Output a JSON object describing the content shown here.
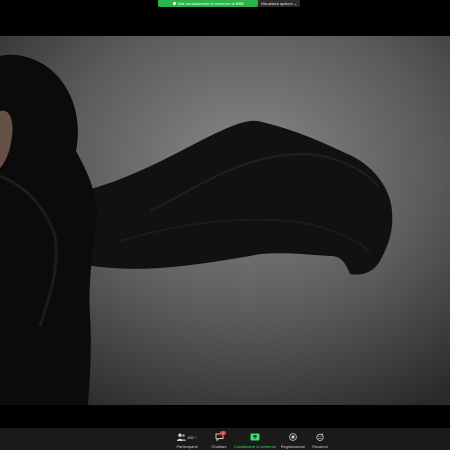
{
  "top_bar": {
    "sharing_label": "Stai visualizzando lo schermo di ∂∂∂∂",
    "view_options_label": "Visualizza opzioni ⌄",
    "accent_color": "#29b34a"
  },
  "shared_screen": {
    "description_icon": "shared-screen-image"
  },
  "toolbar": {
    "participants": {
      "label": "Partecipanti",
      "count": "180",
      "icon": "participants-icon"
    },
    "chat": {
      "label": "Chattare",
      "badge": "1",
      "icon": "chat-icon"
    },
    "share_screen": {
      "label": "Condividere lo schermo",
      "icon": "share-screen-icon",
      "color": "#3ddc6e"
    },
    "record": {
      "label": "Registrazione",
      "icon": "record-icon"
    },
    "reactions": {
      "label": "Reazioni",
      "icon": "reactions-icon"
    }
  }
}
